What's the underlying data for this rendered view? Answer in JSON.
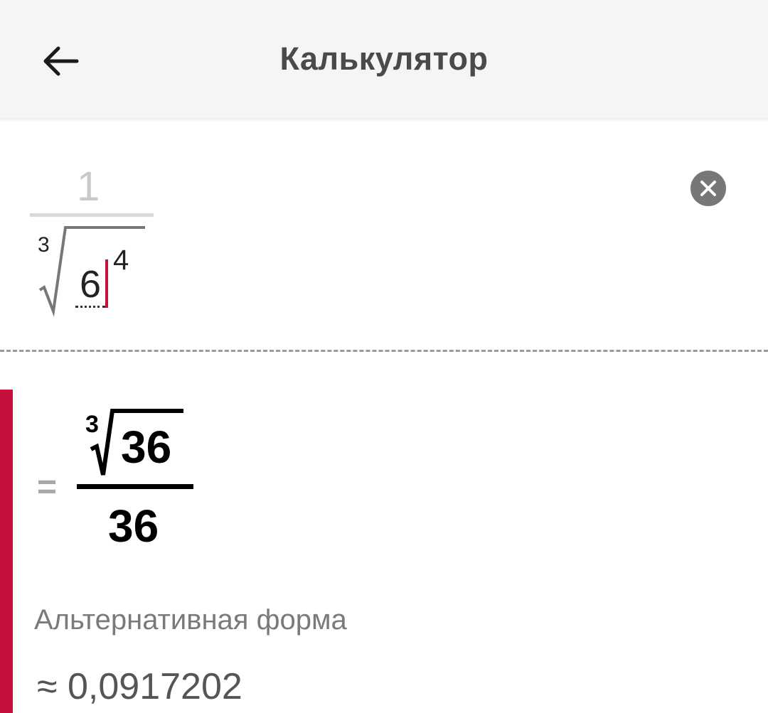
{
  "app_bar": {
    "title": "Калькулятор",
    "back_icon": "arrow-left-icon"
  },
  "input": {
    "numerator": "1",
    "root_index": "3",
    "base": "6",
    "exponent": "4",
    "clear_icon": "close-icon"
  },
  "result": {
    "equals_sign": "=",
    "root_index": "3",
    "radicand": "36",
    "denominator": "36",
    "alt_form_label": "Альтернативная форма",
    "approx_value": "≈ 0,0917202"
  },
  "colors": {
    "accent": "#c4103a",
    "appbar_bg": "#f5f5f5",
    "title_text": "#4a4a4a",
    "clear_button": "#777777"
  }
}
